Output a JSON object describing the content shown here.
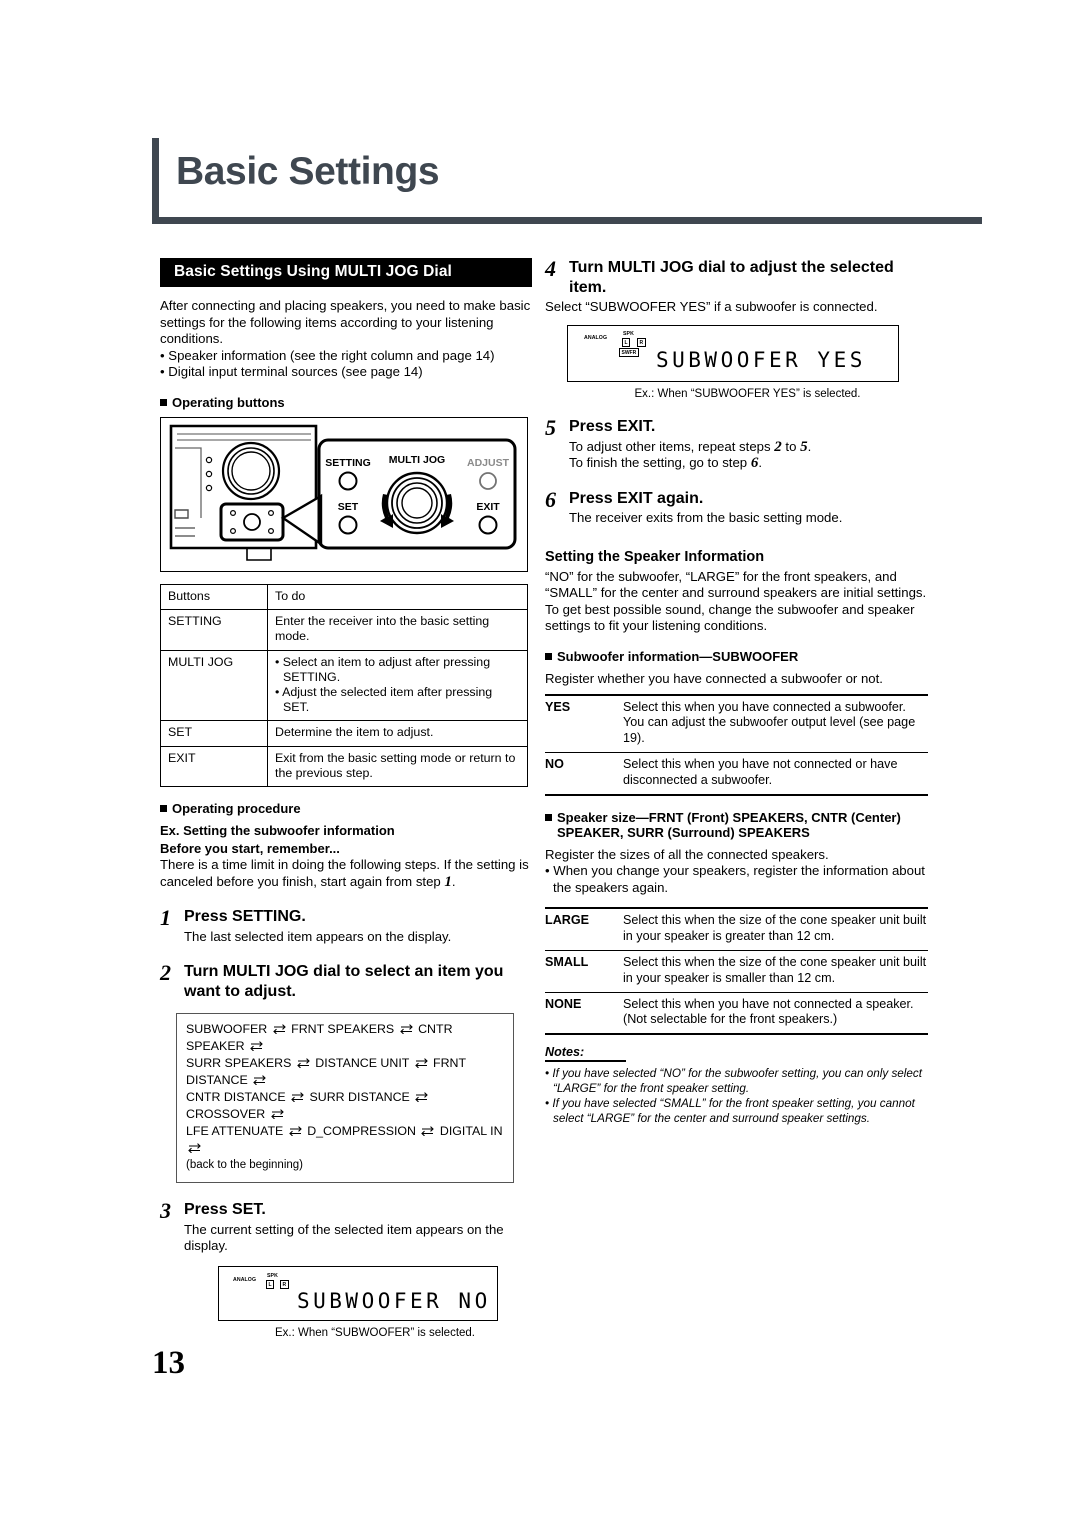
{
  "page": {
    "title": "Basic Settings",
    "number": "13"
  },
  "left": {
    "banner": "Basic Settings Using MULTI JOG Dial",
    "intro": "After connecting and placing speakers, you need to make basic settings for the following items according to your listening conditions.",
    "intro_bullets": [
      "• Speaker information (see the right column and page 14)",
      "• Digital input terminal sources (see page 14)"
    ],
    "operating_buttons_head": "Operating buttons",
    "illustration": {
      "label_setting": "SETTING",
      "label_multi_jog": "MULTI JOG",
      "label_adjust": "ADJUST",
      "label_set": "SET",
      "label_exit": "EXIT"
    },
    "buttons_table": {
      "headers": [
        "Buttons",
        "To do"
      ],
      "rows": [
        {
          "button": "SETTING",
          "todo": [
            "Enter the receiver into the basic setting mode."
          ],
          "bulleted": false
        },
        {
          "button": "MULTI JOG",
          "todo": [
            "• Select an item to adjust after pressing SETTING.",
            "• Adjust the selected item after pressing SET."
          ],
          "bulleted": true
        },
        {
          "button": "SET",
          "todo": [
            "Determine the item to adjust."
          ],
          "bulleted": false
        },
        {
          "button": "EXIT",
          "todo": [
            "Exit from the basic setting mode or return to the previous step."
          ],
          "bulleted": false
        }
      ]
    },
    "operating_procedure_head": "Operating procedure",
    "example_head": "Ex. Setting the subwoofer information",
    "remember_head": "Before you start, remember...",
    "remember_body_1": "There is a time limit in doing the following steps. If the setting is canceled before you finish, start again from step ",
    "remember_step": "1",
    "remember_body_2": ".",
    "step1": {
      "num": "1",
      "title": "Press SETTING.",
      "body": "The last selected item appears on the display."
    },
    "step2": {
      "num": "2",
      "title": "Turn MULTI JOG dial to select an item you want to adjust."
    },
    "flow": {
      "lines": [
        [
          "SUBWOOFER",
          "FRNT SPEAKERS",
          "CNTR SPEAKER",
          ""
        ],
        [
          "SURR SPEAKERS",
          "DISTANCE UNIT",
          "FRNT DISTANCE",
          ""
        ],
        [
          "CNTR DISTANCE",
          "SURR DISTANCE",
          "CROSSOVER",
          ""
        ],
        [
          "LFE ATTENUATE",
          "D_COMPRESSION",
          "DIGITAL IN",
          ""
        ]
      ],
      "footer": "(back to the beginning)"
    },
    "step3": {
      "num": "3",
      "title": "Press SET.",
      "body": "The current setting of the selected item appears on the display."
    },
    "lcd_no": {
      "analog": "ANALOG",
      "spk": "SPK",
      "left": "L",
      "right": "R",
      "text": "SUBWOOFER NO",
      "caption": "Ex.: When “SUBWOOFER” is selected."
    }
  },
  "right": {
    "step4": {
      "num": "4",
      "title": "Turn MULTI JOG dial to adjust the selected item.",
      "body": "Select “SUBWOOFER YES” if a subwoofer is connected."
    },
    "lcd_yes": {
      "analog": "ANALOG",
      "spk": "SPK",
      "left": "L",
      "right": "R",
      "swfr": "SWFR",
      "text": "SUBWOOFER YES",
      "caption": "Ex.: When “SUBWOOFER YES” is selected."
    },
    "step5": {
      "num": "5",
      "title": "Press EXIT.",
      "body_a1": "To adjust other items, repeat steps ",
      "body_a_n1": "2",
      "body_a2": " to ",
      "body_a_n2": "5",
      "body_a3": ".",
      "body_b1": "To finish the setting, go to step ",
      "body_b_n": "6",
      "body_b2": "."
    },
    "step6": {
      "num": "6",
      "title": "Press EXIT again.",
      "body": "The receiver exits from the basic setting mode."
    },
    "speaker_info_head": "Setting the Speaker Information",
    "speaker_info_p1": "“NO” for the subwoofer, “LARGE” for the front speakers, and “SMALL” for the center and surround speakers are initial settings.",
    "speaker_info_p2": "To get best possible sound, change the subwoofer and speaker settings to fit your listening conditions.",
    "subwoofer_head": "Subwoofer information—SUBWOOFER",
    "subwoofer_body": "Register whether you have connected a subwoofer or not.",
    "subwoofer_table": [
      {
        "key": "YES",
        "lines": [
          "Select this when you have connected a subwoofer.",
          "You can adjust the subwoofer output level (see page 19)."
        ]
      },
      {
        "key": "NO",
        "lines": [
          "Select this when you have not connected or have disconnected a subwoofer."
        ]
      }
    ],
    "speaker_size_head": "Speaker size—FRNT (Front) SPEAKERS, CNTR (Center) SPEAKER, SURR (Surround) SPEAKERS",
    "speaker_size_body": "Register the sizes of all the connected speakers.",
    "speaker_size_bullet": "• When you change your speakers, register the information about the speakers again.",
    "speaker_size_table": [
      {
        "key": "LARGE",
        "lines": [
          "Select this when the size of the cone speaker unit built in your speaker is greater than 12 cm."
        ]
      },
      {
        "key": "SMALL",
        "lines": [
          "Select this when the size of the cone speaker unit built in your speaker is smaller than 12 cm."
        ]
      },
      {
        "key": "NONE",
        "lines": [
          "Select this when you have not connected a speaker. (Not selectable for the front speakers.)"
        ]
      }
    ],
    "notes_title": "Notes:",
    "notes": [
      "• If you have selected “NO” for the subwoofer setting, you can only select “LARGE” for the front speaker setting.",
      "• If you have selected “SMALL” for the front speaker setting, you cannot select “LARGE” for the center and surround speaker settings."
    ]
  },
  "colors": {
    "header_rule": "#3f4750",
    "banner_bg": "#000000",
    "text": "#000000"
  }
}
